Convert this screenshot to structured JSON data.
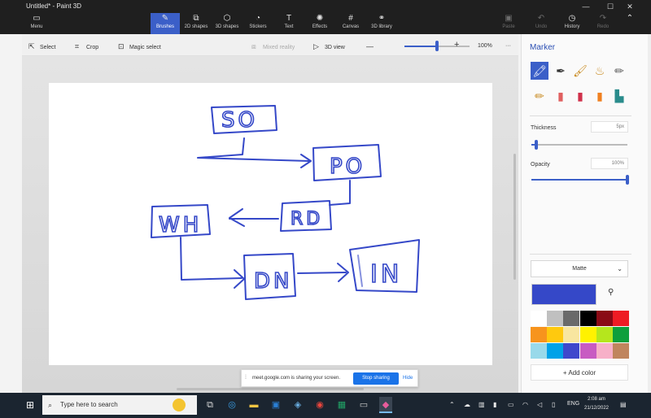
{
  "window": {
    "title": "Untitled* - Paint 3D",
    "minimize": "—",
    "maximize": "☐",
    "close": "✕"
  },
  "ribbon": {
    "menu": "Menu",
    "tabs": [
      {
        "label": "Brushes",
        "icon": "brush-icon"
      },
      {
        "label": "2D shapes",
        "icon": "2d-shapes-icon"
      },
      {
        "label": "3D shapes",
        "icon": "3d-shapes-icon"
      },
      {
        "label": "Stickers",
        "icon": "stickers-icon"
      },
      {
        "label": "Text",
        "icon": "text-icon"
      },
      {
        "label": "Effects",
        "icon": "effects-icon"
      },
      {
        "label": "Canvas",
        "icon": "canvas-icon"
      },
      {
        "label": "3D library",
        "icon": "3d-library-icon"
      }
    ],
    "paste": "Paste",
    "undo": "Undo",
    "history": "History",
    "redo": "Redo"
  },
  "toolbar": {
    "select": "Select",
    "crop": "Crop",
    "magic_select": "Magic select",
    "mixed_reality": "Mixed reality",
    "view_3d": "3D view",
    "zoom_out": "—",
    "zoom_in": "+",
    "zoom": "100%",
    "more": "···"
  },
  "zoom_level": 0.5,
  "panel": {
    "title": "Marker",
    "thickness_label": "Thickness",
    "thickness_value": "5px",
    "opacity_label": "Opacity",
    "opacity_value": "100%",
    "thickness_level": 0.05,
    "opacity_level": 1.0,
    "finish": "Matte",
    "add_color": "Add color",
    "current_color": "#3548c8",
    "palette": [
      "#ffffff",
      "#c0c0c0",
      "#6a6a6a",
      "#000000",
      "#8a0a16",
      "#ee1c24",
      "#f7941d",
      "#ffc90e",
      "#f8e6a0",
      "#fff200",
      "#b5e61d",
      "#0e9f3c",
      "#99d9ea",
      "#00a2e8",
      "#3f48cc",
      "#c85bc2",
      "#f7b0c8",
      "#c0855e"
    ]
  },
  "drawing": {
    "labels": [
      "SO",
      "PO",
      "RD",
      "WH",
      "DN",
      "IN"
    ]
  },
  "share": {
    "message": "meet.google.com is sharing your screen.",
    "stop": "Stop sharing",
    "hide": "Hide"
  },
  "taskbar": {
    "search_placeholder": "Type here to search",
    "language": "ENG",
    "time": "2:08 am",
    "date": "21/12/2022"
  }
}
